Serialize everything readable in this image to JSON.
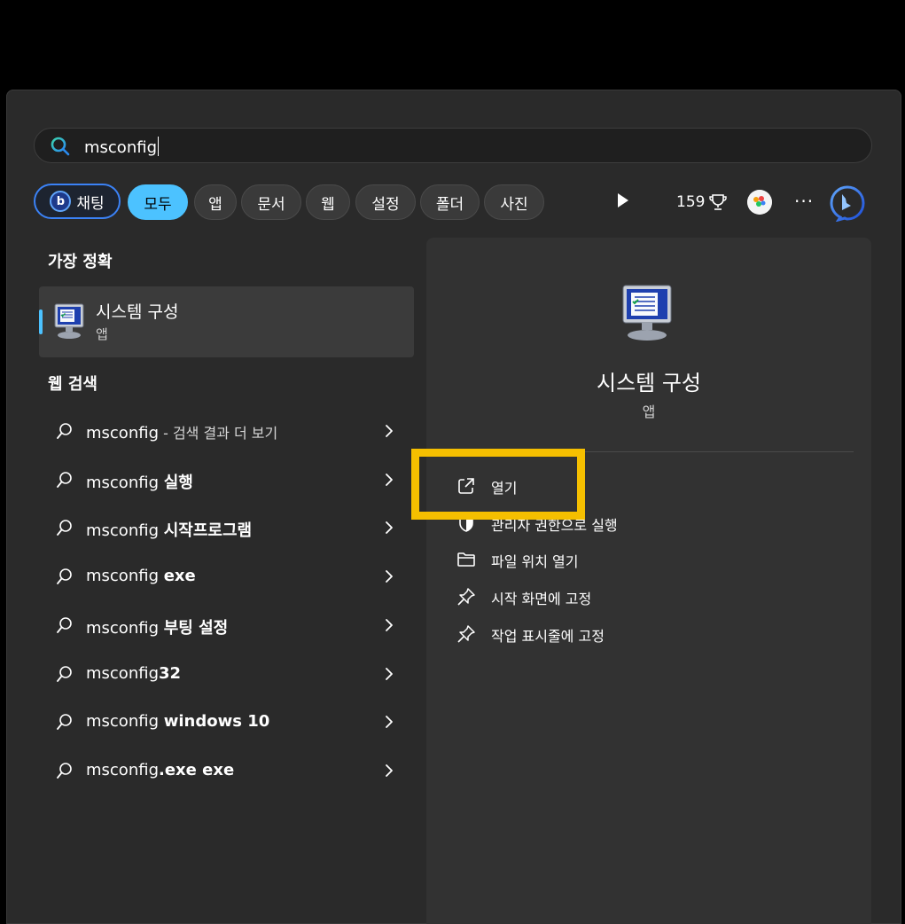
{
  "search": {
    "value": "msconfig"
  },
  "tabs": [
    {
      "label": "채팅",
      "icon": "bing-chat-icon"
    },
    {
      "label": "모두",
      "active": true
    },
    {
      "label": "앱"
    },
    {
      "label": "문서"
    },
    {
      "label": "웹"
    },
    {
      "label": "설정"
    },
    {
      "label": "폴더"
    },
    {
      "label": "사진"
    }
  ],
  "header_right": {
    "points": "159",
    "more": "···"
  },
  "best_match": {
    "heading": "가장 정확",
    "title": "시스템 구성",
    "subtitle": "앱"
  },
  "web_search": {
    "heading": "웹 검색",
    "items": [
      {
        "prefix": "msconfig",
        "bold": "",
        "gray": " - 검색 결과 더 보기"
      },
      {
        "prefix": "msconfig ",
        "bold": "실행",
        "gray": ""
      },
      {
        "prefix": "msconfig ",
        "bold": "시작프로그램",
        "gray": ""
      },
      {
        "prefix": "msconfig ",
        "bold": "exe",
        "gray": ""
      },
      {
        "prefix": "msconfig ",
        "bold": "부팅 설정",
        "gray": ""
      },
      {
        "prefix": "msconfig",
        "bold": "32",
        "gray": ""
      },
      {
        "prefix": "msconfig ",
        "bold": "windows 10",
        "gray": ""
      },
      {
        "prefix": "msconfig",
        "bold": ".exe exe",
        "gray": ""
      }
    ]
  },
  "detail": {
    "title": "시스템 구성",
    "subtitle": "앱",
    "actions": [
      {
        "label": "열기",
        "icon": "open-external-icon"
      },
      {
        "label": "관리자 권한으로 실행",
        "icon": "shield-icon"
      },
      {
        "label": "파일 위치 열기",
        "icon": "folder-icon"
      },
      {
        "label": "시작 화면에 고정",
        "icon": "pin-icon"
      },
      {
        "label": "작업 표시줄에 고정",
        "icon": "pin-icon"
      }
    ]
  },
  "colors": {
    "accent": "#4cc2ff",
    "highlight": "#f5bf00",
    "panel": "#2a2a2a"
  }
}
